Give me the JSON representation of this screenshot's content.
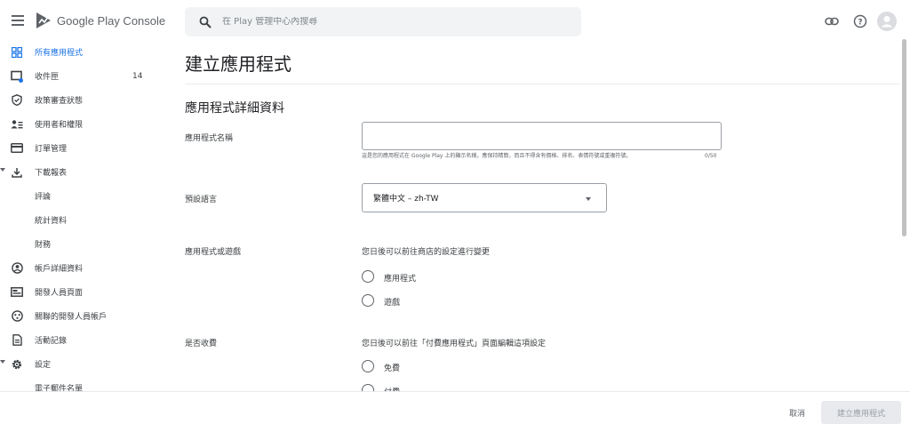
{
  "header": {
    "app_name": "Google Play Console",
    "search_placeholder": "在 Play 管理中心內搜尋"
  },
  "sidebar": {
    "items": [
      {
        "label": "所有應用程式",
        "icon": "apps-grid-icon",
        "active": true
      },
      {
        "label": "收件匣",
        "icon": "inbox-icon",
        "count": "14"
      },
      {
        "label": "政策審查狀態",
        "icon": "shield-icon"
      },
      {
        "label": "使用者和權限",
        "icon": "users-icon"
      },
      {
        "label": "訂單管理",
        "icon": "card-icon"
      },
      {
        "label": "下載報表",
        "icon": "download-icon",
        "expanded": true
      },
      {
        "label": "評論"
      },
      {
        "label": "統計資料"
      },
      {
        "label": "財務"
      },
      {
        "label": "帳戶詳細資料",
        "icon": "account-icon"
      },
      {
        "label": "開發人員頁面",
        "icon": "developer-page-icon"
      },
      {
        "label": "關聯的開發人員帳戶",
        "icon": "linked-accounts-icon"
      },
      {
        "label": "活動記錄",
        "icon": "document-icon"
      },
      {
        "label": "設定",
        "icon": "gear-icon",
        "expanded": true
      },
      {
        "label": "電子郵件名單"
      }
    ]
  },
  "main": {
    "title": "建立應用程式",
    "section_title": "應用程式詳細資料",
    "app_name_label": "應用程式名稱",
    "app_name_value": "",
    "app_name_helper": "這是您的應用程式在 Google Play 上的顯示名稱，應保持精簡，而且不得含有價格、排名、表情符號或重複符號。",
    "app_name_counter": "0/50",
    "default_language_label": "預設語言",
    "default_language_value": "繁體中文 – zh-TW",
    "app_or_game_label": "應用程式或遊戲",
    "app_or_game_hint": "您日後可以前往商店的設定進行變更",
    "app_option": "應用程式",
    "game_option": "遊戲",
    "paid_label": "是否收費",
    "paid_hint": "您日後可以前往「付費應用程式」頁面編輯這項設定",
    "free_option": "免費",
    "paid_option": "付費"
  },
  "footer": {
    "cancel_label": "取消",
    "create_label": "建立應用程式"
  },
  "colors": {
    "accent": "#1a73e8",
    "text": "#202124",
    "muted": "#5f6368",
    "disabled_button": "#e8eaed"
  }
}
